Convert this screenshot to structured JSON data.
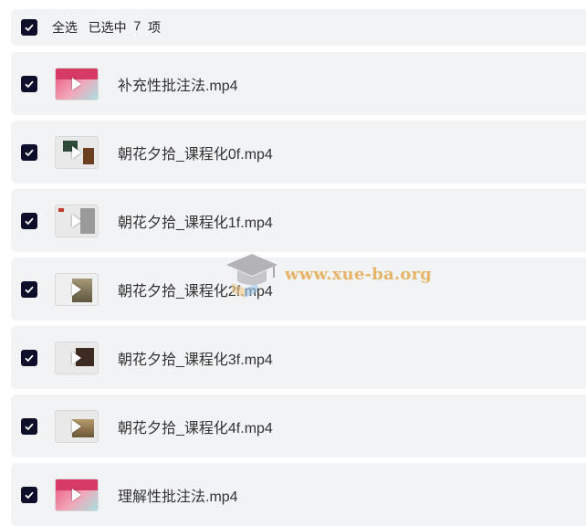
{
  "header": {
    "select_all_label": "全选",
    "selected_prefix": "已选中",
    "selected_count": "7",
    "selected_suffix": "项",
    "checked": true
  },
  "files": [
    {
      "name": "补充性批注法.mp4",
      "checked": true,
      "thumb": "pink"
    },
    {
      "name": "朝花夕拾_课程化0f.mp4",
      "checked": true,
      "thumb": "grey"
    },
    {
      "name": "朝花夕拾_课程化1f.mp4",
      "checked": true,
      "thumb": "grey2"
    },
    {
      "name": "朝花夕拾_课程化2f.mp4",
      "checked": true,
      "thumb": "photo"
    },
    {
      "name": "朝花夕拾_课程化3f.mp4",
      "checked": true,
      "thumb": "dark"
    },
    {
      "name": "朝花夕拾_课程化4f.mp4",
      "checked": true,
      "thumb": "tan"
    },
    {
      "name": "理解性批注法.mp4",
      "checked": true,
      "thumb": "pink"
    }
  ],
  "watermark": {
    "text": "www.xue-ba.org"
  },
  "colors": {
    "checkbox": "#0d0f2a",
    "row_bg": "#f2f3f5",
    "watermark": "#e6b56a"
  }
}
